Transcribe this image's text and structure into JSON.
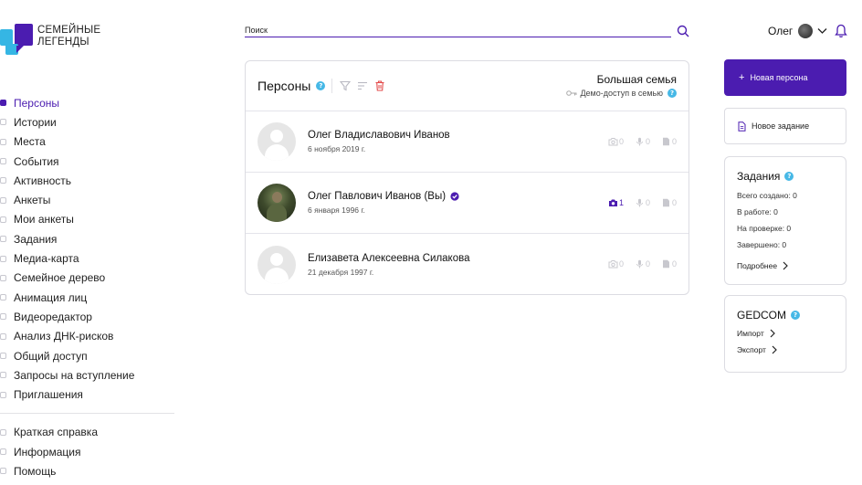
{
  "logo": {
    "line1": "СЕМЕЙНЫЕ",
    "line2": "ЛЕГЕНДЫ"
  },
  "search": {
    "placeholder": "Поиск"
  },
  "user": {
    "name": "Олег"
  },
  "sidebar": {
    "items": [
      {
        "label": "Персоны",
        "active": true
      },
      {
        "label": "Истории"
      },
      {
        "label": "Места"
      },
      {
        "label": "События"
      },
      {
        "label": "Активность"
      },
      {
        "label": "Анкеты"
      },
      {
        "label": "Мои анкеты"
      },
      {
        "label": "Задания"
      },
      {
        "label": "Медиа-карта"
      },
      {
        "label": "Семейное дерево"
      },
      {
        "label": "Анимация лиц"
      },
      {
        "label": "Видеоредактор"
      },
      {
        "label": "Анализ ДНК-рисков"
      },
      {
        "label": "Общий доступ"
      },
      {
        "label": "Запросы на вступление"
      },
      {
        "label": "Приглашения"
      }
    ],
    "bottom": [
      {
        "label": "Краткая справка"
      },
      {
        "label": "Информация"
      },
      {
        "label": "Помощь"
      }
    ]
  },
  "persons": {
    "title": "Персоны",
    "help": "?",
    "family_name": "Большая семья",
    "demo_access": "Демо-доступ в семью",
    "rows": [
      {
        "name": "Олег Владиславович Иванов",
        "date": "6 ноября 2019 г.",
        "photos": "0",
        "audio": "0",
        "docs": "0",
        "has_photo": false,
        "verified": false
      },
      {
        "name": "Олег Павлович Иванов (Вы)",
        "date": "6 января 1996 г.",
        "photos": "1",
        "audio": "0",
        "docs": "0",
        "has_photo": true,
        "verified": true
      },
      {
        "name": "Елизавета Алексеевна Силакова",
        "date": "21 декабря 1997 г.",
        "photos": "0",
        "audio": "0",
        "docs": "0",
        "has_photo": false,
        "verified": false
      }
    ]
  },
  "actions": {
    "new_person": "Новая персона",
    "new_task": "Новое задание"
  },
  "tasks": {
    "title": "Задания",
    "created": "Всего создано: 0",
    "in_progress": "В работе: 0",
    "review": "На проверке: 0",
    "done": "Завершено: 0",
    "more": "Подробнее"
  },
  "gedcom": {
    "title": "GEDCOM",
    "import": "Импорт",
    "export": "Экспорт"
  },
  "colors": {
    "accent": "#4b1cb0",
    "help": "#46b8e6",
    "logo_blue": "#35b6e4"
  }
}
